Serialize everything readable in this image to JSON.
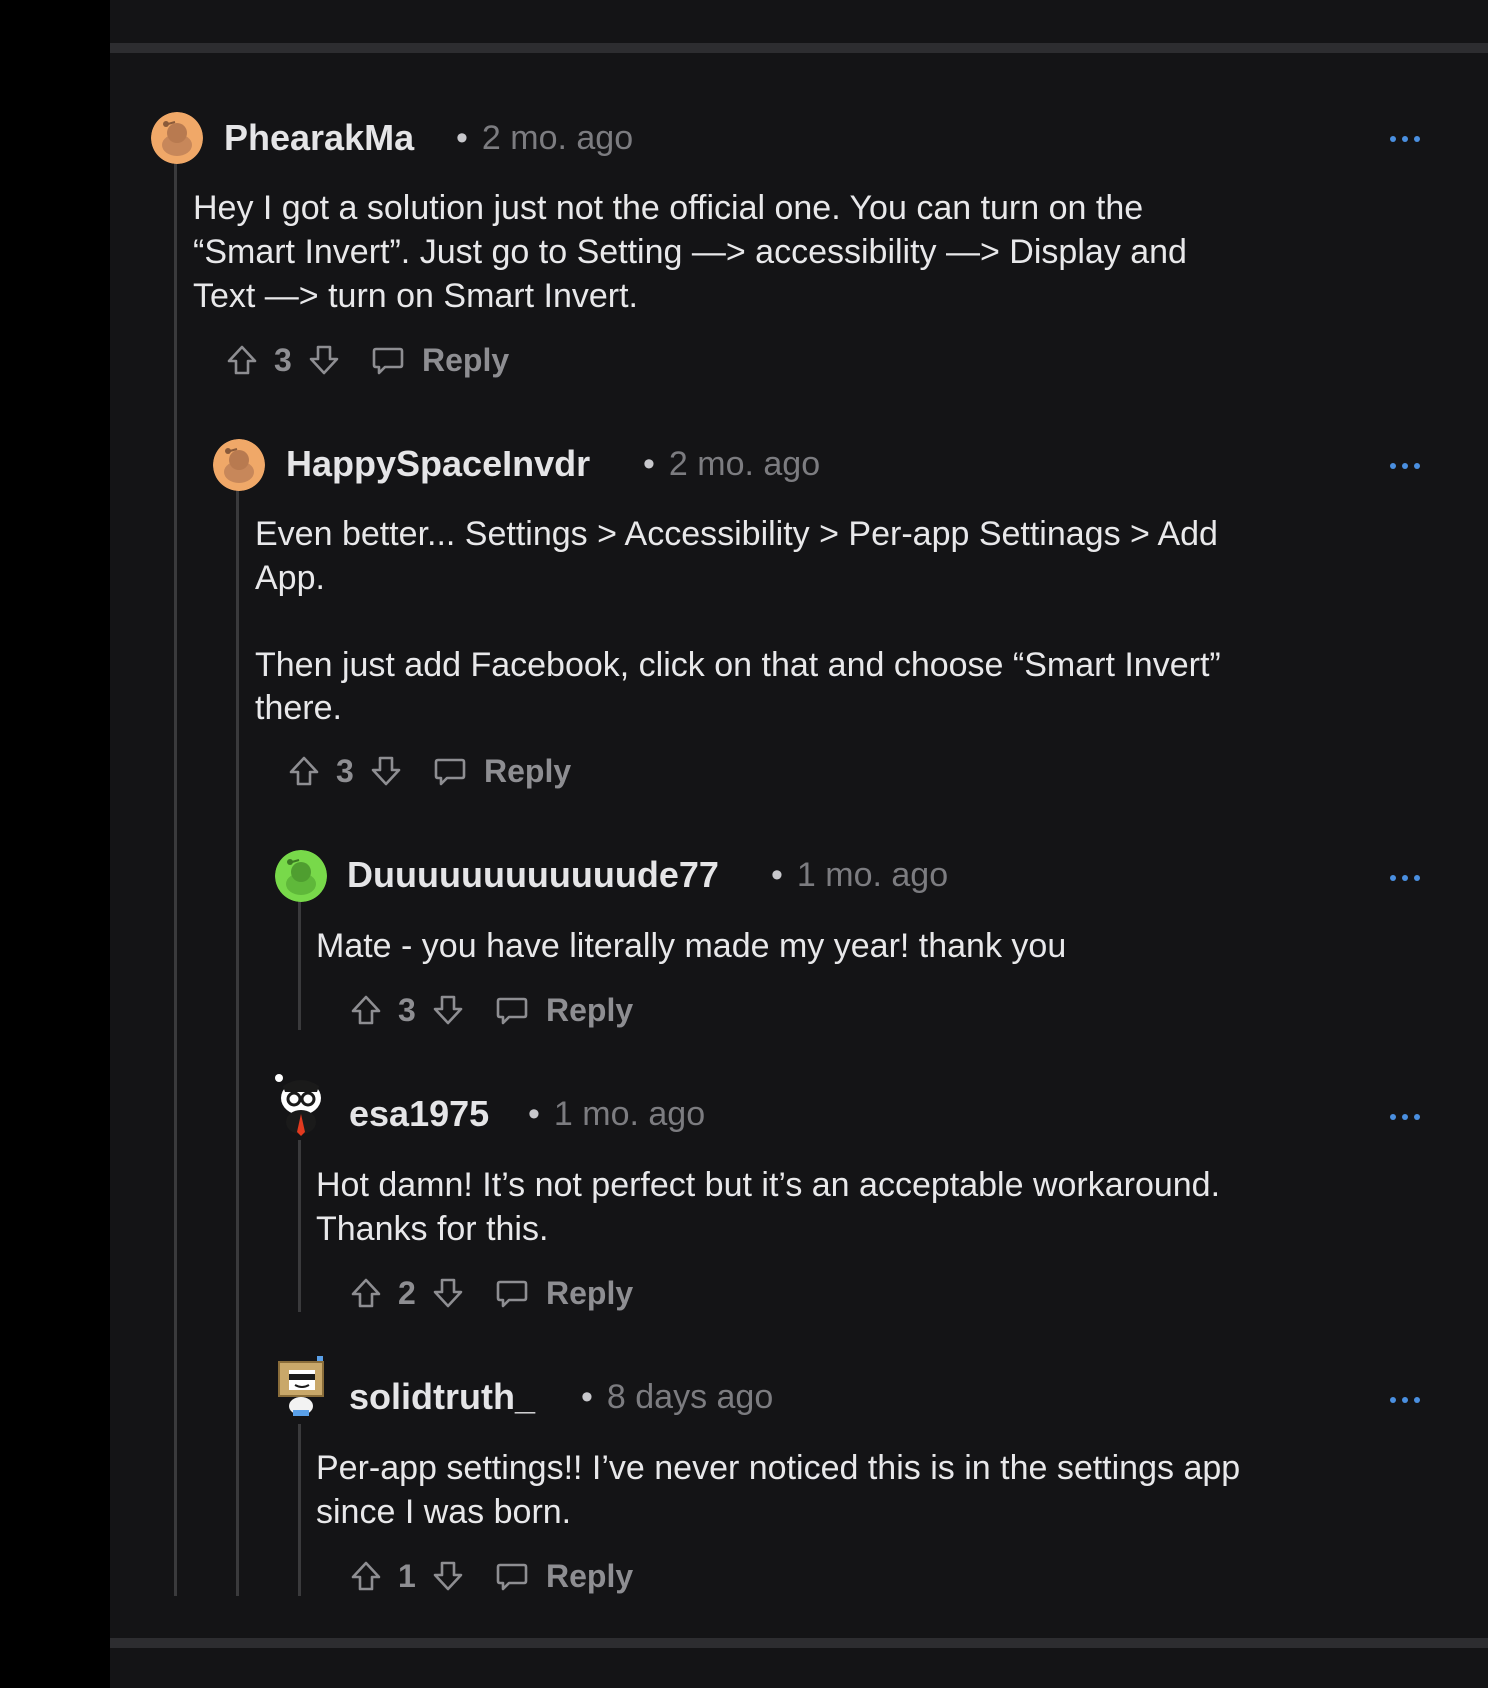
{
  "colors": {
    "background": "#141416",
    "link_blue": "#4a8fe0",
    "muted": "#8e8e92",
    "text": "#e8e8ea"
  },
  "comments": [
    {
      "username": "PhearakMa",
      "time": "2 mo. ago",
      "body": "Hey I got a solution just not the official one. You can turn on the\n“Smart Invert”. Just go to Setting —> accessibility —> Display and\nText —> turn on Smart Invert.",
      "votes": "3",
      "reply": "Reply",
      "avatar": "snoo-orange-avatar"
    },
    {
      "username": "HappySpaceInvdr",
      "time": "2 mo. ago",
      "body": "Even better... Settings > Accessibility > Per-app Settinags > Add\nApp.\n\nThen just add Facebook, click on that and choose “Smart Invert”\nthere.",
      "votes": "3",
      "reply": "Reply",
      "avatar": "snoo-orange-avatar"
    },
    {
      "username": "Duuuuuuuuuuuude77",
      "time": "1 mo. ago",
      "body": "Mate - you have literally made my year! thank you",
      "votes": "3",
      "reply": "Reply",
      "avatar": "snoo-green-avatar"
    },
    {
      "username": "esa1975",
      "time": "1 mo. ago",
      "body": "Hot damn! It’s not perfect but it’s an acceptable workaround.\nThanks for this.",
      "votes": "2",
      "reply": "Reply",
      "avatar": "snoo-glasses-avatar"
    },
    {
      "username": "solidtruth_",
      "time": "8 days ago",
      "body": "Per-app settings!! I’ve never noticed this is in the settings app\nsince I was born.",
      "votes": "1",
      "reply": "Reply",
      "avatar": "snoo-box-avatar"
    }
  ],
  "separator": "•"
}
